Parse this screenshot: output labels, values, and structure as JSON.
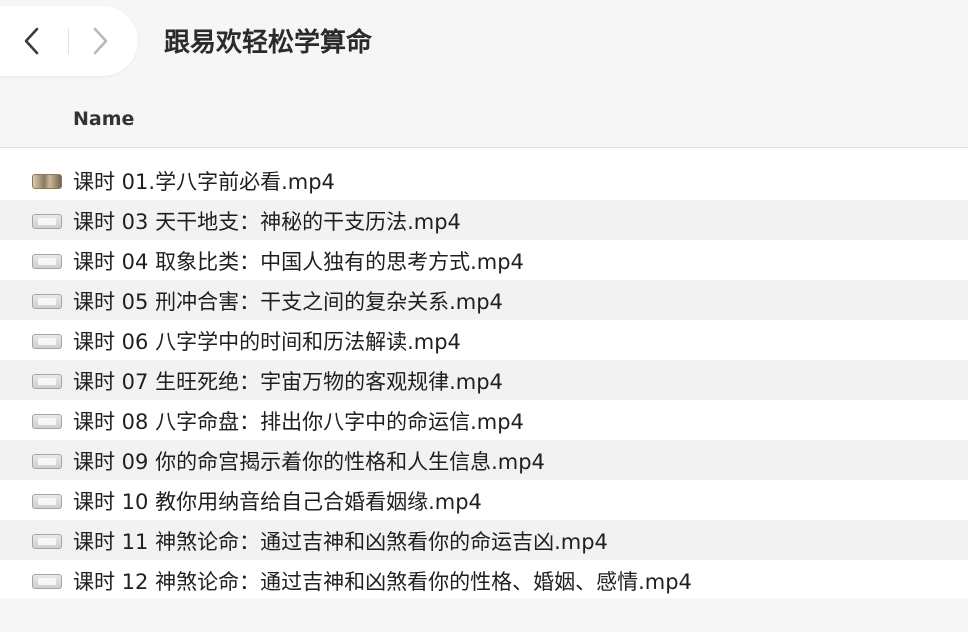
{
  "window": {
    "title": "跟易欢轻松学算命",
    "nav": {
      "back_icon": "chevron-left-icon",
      "forward_icon": "chevron-right-icon"
    }
  },
  "list_header": {
    "name": "Name"
  },
  "files": [
    {
      "name": "课时 01.学八字前必看.mp4",
      "icon": "video-thumbnail-icon"
    },
    {
      "name": "课时 03 天干地支：神秘的干支历法.mp4",
      "icon": "video-file-icon"
    },
    {
      "name": "课时 04 取象比类：中国人独有的思考方式.mp4",
      "icon": "video-file-icon"
    },
    {
      "name": "课时 05 刑冲合害：干支之间的复杂关系.mp4",
      "icon": "video-file-icon"
    },
    {
      "name": "课时 06 八字学中的时间和历法解读.mp4",
      "icon": "video-file-icon"
    },
    {
      "name": "课时 07 生旺死绝：宇宙万物的客观规律.mp4",
      "icon": "video-file-icon"
    },
    {
      "name": "课时 08 八字命盘：排出你八字中的命运信.mp4",
      "icon": "video-file-icon"
    },
    {
      "name": "课时 09 你的命宫揭示着你的性格和人生信息.mp4",
      "icon": "video-file-icon"
    },
    {
      "name": "课时 10 教你用纳音给自己合婚看姻缘.mp4",
      "icon": "video-file-icon"
    },
    {
      "name": "课时 11 神煞论命：通过吉神和凶煞看你的命运吉凶.mp4",
      "icon": "video-file-icon"
    },
    {
      "name": "课时 12 神煞论命：通过吉神和凶煞看你的性格、婚姻、感情.mp4",
      "icon": "video-file-icon"
    }
  ]
}
